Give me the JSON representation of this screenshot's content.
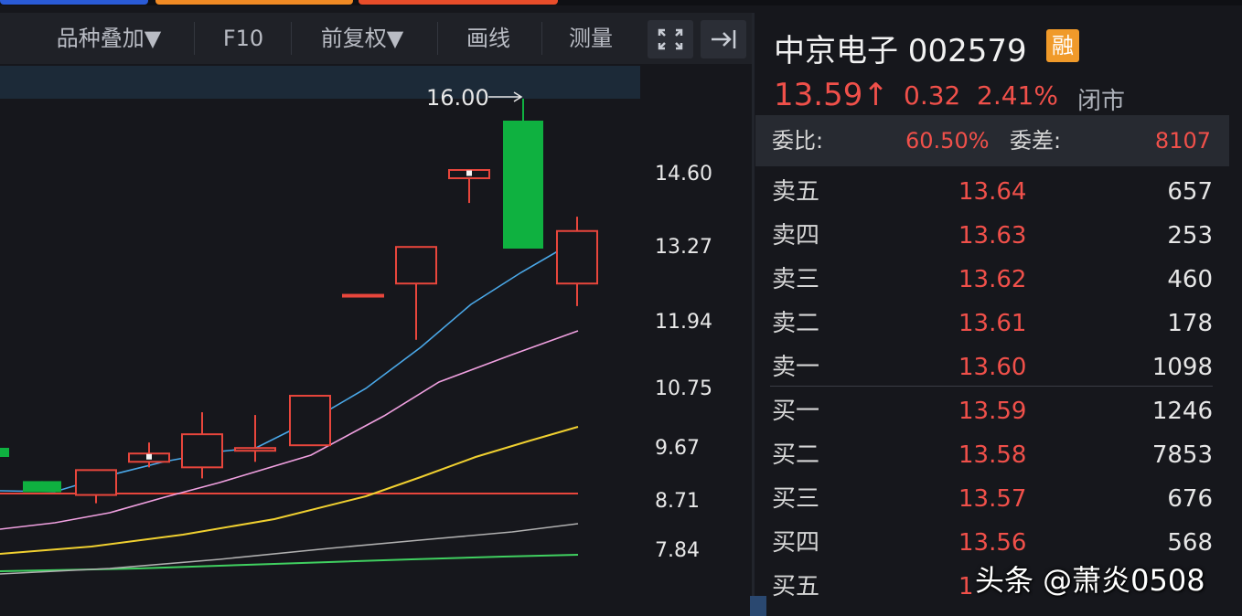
{
  "toolbar": {
    "variety_overlay": "品种叠加▼",
    "f10": "F10",
    "adjust": "前复权▼",
    "draw": "画线",
    "measure": "测量"
  },
  "chart": {
    "peak_label": "16.00",
    "y_ticks": [
      "14.60",
      "13.27",
      "11.94",
      "10.75",
      "9.67",
      "8.71",
      "7.84"
    ],
    "colors": {
      "up": "#e8463c",
      "down": "#0fb140",
      "ma5": "#4aa8e8",
      "ma10": "#f0a0e0",
      "ma20": "#f0d030",
      "ma30": "#b0b0b0",
      "ma60": "#40d060",
      "ref": "#e8463c"
    }
  },
  "chart_data": {
    "type": "candlestick",
    "candles": [
      {
        "open": 9.1,
        "close": 8.9,
        "high": 9.1,
        "low": 8.9
      },
      {
        "open": 8.85,
        "close": 9.3,
        "high": 9.3,
        "low": 8.7
      },
      {
        "open": 9.45,
        "close": 9.6,
        "high": 9.8,
        "low": 9.35
      },
      {
        "open": 9.35,
        "close": 9.95,
        "high": 10.35,
        "low": 9.15
      },
      {
        "open": 9.65,
        "close": 9.7,
        "high": 10.3,
        "low": 9.45
      },
      {
        "open": 9.75,
        "close": 10.65,
        "high": 10.65,
        "low": 9.75
      },
      {
        "open": 12.45,
        "close": 12.45,
        "high": 12.45,
        "low": 12.45
      },
      {
        "open": 12.65,
        "close": 13.3,
        "high": 13.3,
        "low": 11.65
      },
      {
        "open": 14.55,
        "close": 14.7,
        "high": 14.7,
        "low": 14.1
      },
      {
        "open": 15.6,
        "close": 13.27,
        "high": 16.0,
        "low": 13.27
      },
      {
        "open": 12.65,
        "close": 13.59,
        "high": 13.85,
        "low": 12.25
      }
    ]
  },
  "quote": {
    "name_code": "中京电子 002579",
    "margin_badge": "融",
    "price": "13.59↑",
    "change": "0.32",
    "change_pct": "2.41%",
    "status": "闭市",
    "weibi_label": "委比:",
    "weibi_value": "60.50%",
    "weicha_label": "委差:",
    "weicha_value": "8107"
  },
  "orderbook": {
    "asks": [
      {
        "label": "卖五",
        "price": "13.64",
        "vol": "657"
      },
      {
        "label": "卖四",
        "price": "13.63",
        "vol": "253"
      },
      {
        "label": "卖三",
        "price": "13.62",
        "vol": "460"
      },
      {
        "label": "卖二",
        "price": "13.61",
        "vol": "178"
      },
      {
        "label": "卖一",
        "price": "13.60",
        "vol": "1098"
      }
    ],
    "bids": [
      {
        "label": "买一",
        "price": "13.59",
        "vol": "1246"
      },
      {
        "label": "买二",
        "price": "13.58",
        "vol": "7853"
      },
      {
        "label": "买三",
        "price": "13.57",
        "vol": "676"
      },
      {
        "label": "买四",
        "price": "13.56",
        "vol": "568"
      },
      {
        "label": "买五",
        "price": "1",
        "vol": ""
      }
    ]
  },
  "watermark": "头条 @萧炎0508"
}
